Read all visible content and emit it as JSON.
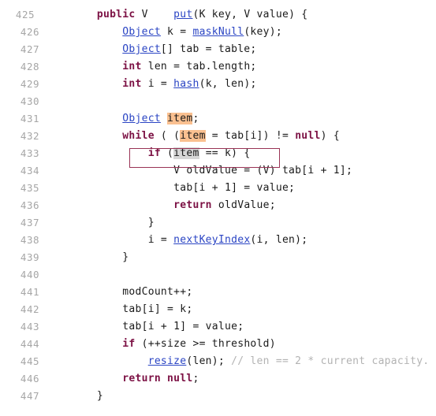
{
  "editor": {
    "background_color": "#ffffff",
    "gutter_color": "#a6a6a6",
    "keyword_color": "#7c1144",
    "link_color": "#2b45c4",
    "comment_color": "#b3b3b3",
    "highlight_orange": "#fac090",
    "highlight_gray": "#d6d6d6",
    "focus_box_color": "#993355",
    "line_height": 22,
    "first_line_number": 425,
    "last_line_number": 447
  },
  "focus_box": {
    "line_number": 433,
    "label": "if (item == k) {"
  },
  "lines": [
    {
      "num": "425",
      "tokens": [
        {
          "t": "        ",
          "k": "plain"
        },
        {
          "t": "public",
          "k": "kw"
        },
        {
          "t": " V    ",
          "k": "plain"
        },
        {
          "t": "put",
          "k": "lnk"
        },
        {
          "t": "(K key, V value) {",
          "k": "plain"
        }
      ]
    },
    {
      "num": "426",
      "tokens": [
        {
          "t": "            ",
          "k": "plain"
        },
        {
          "t": "Object",
          "k": "lnk"
        },
        {
          "t": " k = ",
          "k": "plain"
        },
        {
          "t": "maskNull",
          "k": "lnk"
        },
        {
          "t": "(key);",
          "k": "plain"
        }
      ]
    },
    {
      "num": "427",
      "tokens": [
        {
          "t": "            ",
          "k": "plain"
        },
        {
          "t": "Object",
          "k": "lnk"
        },
        {
          "t": "[] tab = table;",
          "k": "plain"
        }
      ]
    },
    {
      "num": "428",
      "tokens": [
        {
          "t": "            ",
          "k": "plain"
        },
        {
          "t": "int",
          "k": "kw"
        },
        {
          "t": " len = tab.length;",
          "k": "plain"
        }
      ]
    },
    {
      "num": "429",
      "tokens": [
        {
          "t": "            ",
          "k": "plain"
        },
        {
          "t": "int",
          "k": "kw"
        },
        {
          "t": " i = ",
          "k": "plain"
        },
        {
          "t": "hash",
          "k": "lnk"
        },
        {
          "t": "(k, len);",
          "k": "plain"
        }
      ]
    },
    {
      "num": "430",
      "tokens": []
    },
    {
      "num": "431",
      "tokens": [
        {
          "t": "            ",
          "k": "plain"
        },
        {
          "t": "Object",
          "k": "lnk"
        },
        {
          "t": " ",
          "k": "plain"
        },
        {
          "t": "item",
          "k": "hl-orange"
        },
        {
          "t": ";",
          "k": "plain"
        }
      ]
    },
    {
      "num": "432",
      "tokens": [
        {
          "t": "            ",
          "k": "plain"
        },
        {
          "t": "while",
          "k": "kw"
        },
        {
          "t": " ( (",
          "k": "plain"
        },
        {
          "t": "item",
          "k": "hl-orange"
        },
        {
          "t": " = tab[i]) != ",
          "k": "plain"
        },
        {
          "t": "null",
          "k": "kw"
        },
        {
          "t": ") {",
          "k": "plain"
        }
      ]
    },
    {
      "num": "433",
      "tokens": [
        {
          "t": "                ",
          "k": "plain"
        },
        {
          "t": "if",
          "k": "kw"
        },
        {
          "t": " (",
          "k": "plain"
        },
        {
          "t": "item",
          "k": "hl-gray"
        },
        {
          "t": " == k) {",
          "k": "plain"
        }
      ]
    },
    {
      "num": "434",
      "tokens": [
        {
          "t": "                    V oldValue = (V) tab[i + 1];",
          "k": "plain"
        }
      ]
    },
    {
      "num": "435",
      "tokens": [
        {
          "t": "                    tab[i + 1] = value;",
          "k": "plain"
        }
      ]
    },
    {
      "num": "436",
      "tokens": [
        {
          "t": "                    ",
          "k": "plain"
        },
        {
          "t": "return",
          "k": "kw"
        },
        {
          "t": " oldValue;",
          "k": "plain"
        }
      ]
    },
    {
      "num": "437",
      "tokens": [
        {
          "t": "                }",
          "k": "plain"
        }
      ]
    },
    {
      "num": "438",
      "tokens": [
        {
          "t": "                i = ",
          "k": "plain"
        },
        {
          "t": "nextKeyIndex",
          "k": "lnk"
        },
        {
          "t": "(i, len);",
          "k": "plain"
        }
      ]
    },
    {
      "num": "439",
      "tokens": [
        {
          "t": "            }",
          "k": "plain"
        }
      ]
    },
    {
      "num": "440",
      "tokens": []
    },
    {
      "num": "441",
      "tokens": [
        {
          "t": "            modCount++;",
          "k": "plain"
        }
      ]
    },
    {
      "num": "442",
      "tokens": [
        {
          "t": "            tab[i] = k;",
          "k": "plain"
        }
      ]
    },
    {
      "num": "443",
      "tokens": [
        {
          "t": "            tab[i + 1] = value;",
          "k": "plain"
        }
      ]
    },
    {
      "num": "444",
      "tokens": [
        {
          "t": "            ",
          "k": "plain"
        },
        {
          "t": "if",
          "k": "kw"
        },
        {
          "t": " (++size >= threshold)",
          "k": "plain"
        }
      ]
    },
    {
      "num": "445",
      "tokens": [
        {
          "t": "                ",
          "k": "plain"
        },
        {
          "t": "resize",
          "k": "lnk"
        },
        {
          "t": "(len); ",
          "k": "plain"
        },
        {
          "t": "// len == 2 * current capacity.",
          "k": "cmt"
        }
      ]
    },
    {
      "num": "446",
      "tokens": [
        {
          "t": "            ",
          "k": "plain"
        },
        {
          "t": "return null",
          "k": "kw"
        },
        {
          "t": ";",
          "k": "plain"
        }
      ]
    },
    {
      "num": "447",
      "tokens": [
        {
          "t": "        }",
          "k": "plain"
        }
      ]
    }
  ]
}
